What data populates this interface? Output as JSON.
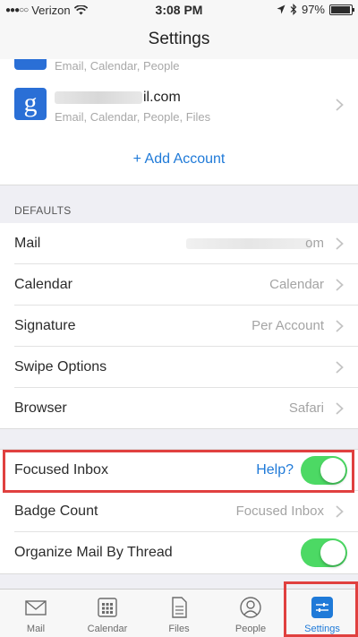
{
  "status": {
    "carrier": "Verizon",
    "signal": "●●●○○",
    "time": "3:08 PM",
    "battery": "97%",
    "battery_level": 0.97
  },
  "nav": {
    "title": "Settings"
  },
  "accounts": {
    "partial_subtitle": "Email, Calendar, People",
    "google": {
      "logo": "g",
      "email_visible": "il.com",
      "subtitle": "Email, Calendar, People, Files"
    },
    "add_label": "+ Add Account"
  },
  "defaults": {
    "header": "DEFAULTS",
    "rows": [
      {
        "label": "Mail",
        "value": "om"
      },
      {
        "label": "Calendar",
        "value": "Calendar"
      },
      {
        "label": "Signature",
        "value": "Per Account"
      },
      {
        "label": "Swipe Options",
        "value": ""
      },
      {
        "label": "Browser",
        "value": "Safari"
      }
    ]
  },
  "inbox": {
    "focused_label": "Focused Inbox",
    "help_label": "Help?",
    "focused_on": true,
    "badge_label": "Badge Count",
    "badge_value": "Focused Inbox",
    "thread_label": "Organize Mail By Thread",
    "thread_on": true
  },
  "tabs": [
    {
      "label": "Mail",
      "icon": "envelope-icon",
      "active": false
    },
    {
      "label": "Calendar",
      "icon": "calendar-icon",
      "active": false
    },
    {
      "label": "Files",
      "icon": "file-icon",
      "active": false
    },
    {
      "label": "People",
      "icon": "person-icon",
      "active": false
    },
    {
      "label": "Settings",
      "icon": "sliders-icon",
      "active": true
    }
  ],
  "colors": {
    "accent": "#1f7ad8",
    "toggle_on": "#4cd964",
    "highlight": "#e0403f"
  }
}
